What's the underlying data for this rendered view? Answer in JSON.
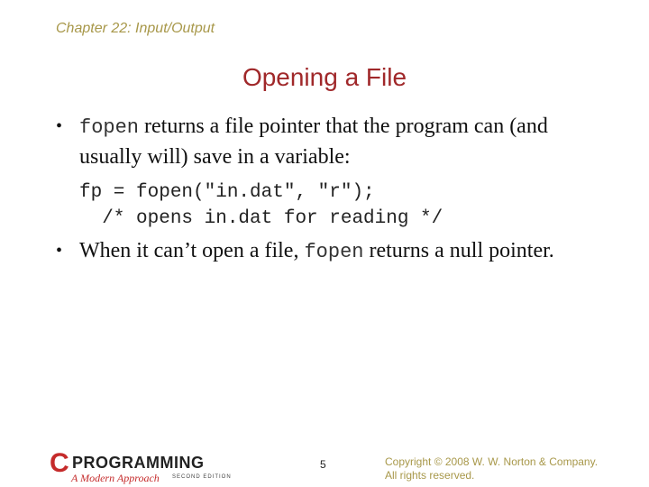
{
  "header": {
    "chapter": "Chapter 22: Input/Output"
  },
  "slide": {
    "title": "Opening a File",
    "bullets": [
      {
        "code_lead": "fopen",
        "text_after": " returns a file pointer that the program can (and usually will) save in a variable:"
      },
      {
        "text_before": "When it can’t open a file, ",
        "code_mid": "fopen",
        "text_after": " returns a null pointer."
      }
    ],
    "code_lines": [
      "fp = fopen(\"in.dat\", \"r\");",
      "  /* opens in.dat for reading */"
    ],
    "bullet_glyph": "•"
  },
  "footer": {
    "logo": {
      "letter": "C",
      "word": "PROGRAMMING",
      "subtitle": "A Modern Approach",
      "edition": "SECOND EDITION"
    },
    "page_number": "5",
    "copyright_line1": "Copyright © 2008 W. W. Norton & Company.",
    "copyright_line2": "All rights reserved."
  },
  "colors": {
    "title": "#a0282a",
    "header": "#a8984a",
    "logo_red": "#c52b2b"
  }
}
